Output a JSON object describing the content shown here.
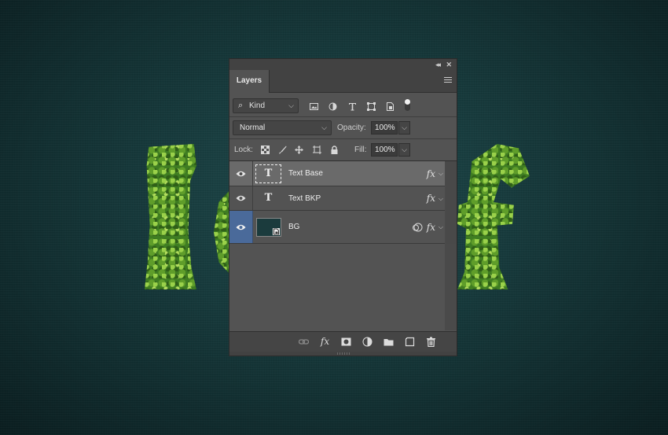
{
  "panel": {
    "tab_label": "Layers",
    "filter": {
      "kind_label": "Kind",
      "filter_icons": [
        "image-filter-icon",
        "adjustment-filter-icon",
        "type-filter-icon",
        "shape-filter-icon",
        "smart-object-filter-icon"
      ],
      "filter_toggle_on": true
    },
    "blend": {
      "mode": "Normal",
      "opacity_label": "Opacity:",
      "opacity_value": "100%"
    },
    "lock": {
      "lock_label": "Lock:",
      "lock_icons": [
        "lock-transparent-icon",
        "lock-image-icon",
        "lock-position-icon",
        "lock-artboard-icon",
        "lock-all-icon"
      ],
      "fill_label": "Fill:",
      "fill_value": "100%"
    },
    "layers": [
      {
        "name": "Text Base",
        "thumb": "T",
        "type": "text",
        "selected": true,
        "visible": true,
        "fx": "fx"
      },
      {
        "name": "Text BKP",
        "thumb": "T",
        "type": "text",
        "selected": false,
        "visible": true,
        "fx": "fx"
      },
      {
        "name": "BG",
        "thumb": "",
        "type": "smart-object",
        "selected": false,
        "visible": true,
        "fx": "fx",
        "highlight_color": "#4a6a9a"
      }
    ],
    "bottom_icons": [
      "link-icon",
      "fx-icon",
      "mask-icon",
      "adjustment-icon",
      "folder-icon",
      "new-layer-icon",
      "trash-icon"
    ],
    "fx_bottom_label": "fx"
  },
  "colors": {
    "panel_bg": "#535353",
    "selected_row": "#6a6a6a",
    "eye_highlight": "#4a6a9a",
    "canvas_bg": "#173a3c"
  }
}
